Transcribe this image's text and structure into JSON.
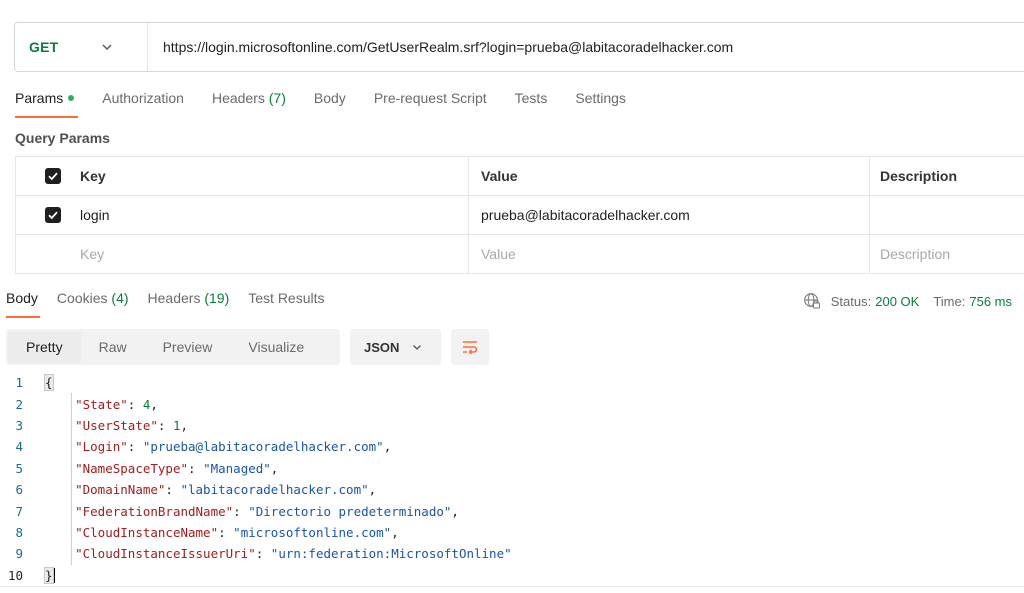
{
  "request": {
    "method": "GET",
    "url": "https://login.microsoftonline.com/GetUserRealm.srf?login=prueba@labitacoradelhacker.com"
  },
  "request_tabs": {
    "params": "Params",
    "authorization": "Authorization",
    "headers": "Headers",
    "headers_count": "(7)",
    "body": "Body",
    "pre_request": "Pre-request Script",
    "tests": "Tests",
    "settings": "Settings"
  },
  "query_params": {
    "title": "Query Params",
    "headers": {
      "key": "Key",
      "value": "Value",
      "description": "Description"
    },
    "rows": [
      {
        "key": "login",
        "value": "prueba@labitacoradelhacker.com",
        "description": ""
      }
    ],
    "placeholder": {
      "key": "Key",
      "value": "Value",
      "description": "Description"
    }
  },
  "response_tabs": {
    "body": "Body",
    "cookies": "Cookies",
    "cookies_count": "(4)",
    "headers": "Headers",
    "headers_count": "(19)",
    "test_results": "Test Results"
  },
  "response_status": {
    "status_label": "Status:",
    "status_value": "200 OK",
    "time_label": "Time:",
    "time_value": "756 ms"
  },
  "view_modes": [
    "Pretty",
    "Raw",
    "Preview",
    "Visualize"
  ],
  "format": "JSON",
  "code": {
    "open": "{",
    "close": "}",
    "entries": [
      {
        "key": "\"State\"",
        "value": "4",
        "kind": "number"
      },
      {
        "key": "\"UserState\"",
        "value": "1",
        "kind": "number"
      },
      {
        "key": "\"Login\"",
        "value": "\"prueba@labitacoradelhacker.com\"",
        "kind": "string"
      },
      {
        "key": "\"NameSpaceType\"",
        "value": "\"Managed\"",
        "kind": "string"
      },
      {
        "key": "\"DomainName\"",
        "value": "\"labitacoradelhacker.com\"",
        "kind": "string"
      },
      {
        "key": "\"FederationBrandName\"",
        "value": "\"Directorio predeterminado\"",
        "kind": "string"
      },
      {
        "key": "\"CloudInstanceName\"",
        "value": "\"microsoftonline.com\"",
        "kind": "string"
      },
      {
        "key": "\"CloudInstanceIssuerUri\"",
        "value": "\"urn:federation:MicrosoftOnline\"",
        "kind": "string"
      }
    ],
    "line_numbers": [
      "1",
      "2",
      "3",
      "4",
      "5",
      "6",
      "7",
      "8",
      "9",
      "10"
    ]
  },
  "colors": {
    "accent": "#ff6c37",
    "get_method": "#0a7d3a",
    "json_key": "#a11e1e",
    "json_string": "#1a56a4",
    "json_number": "#0a7d3a"
  }
}
